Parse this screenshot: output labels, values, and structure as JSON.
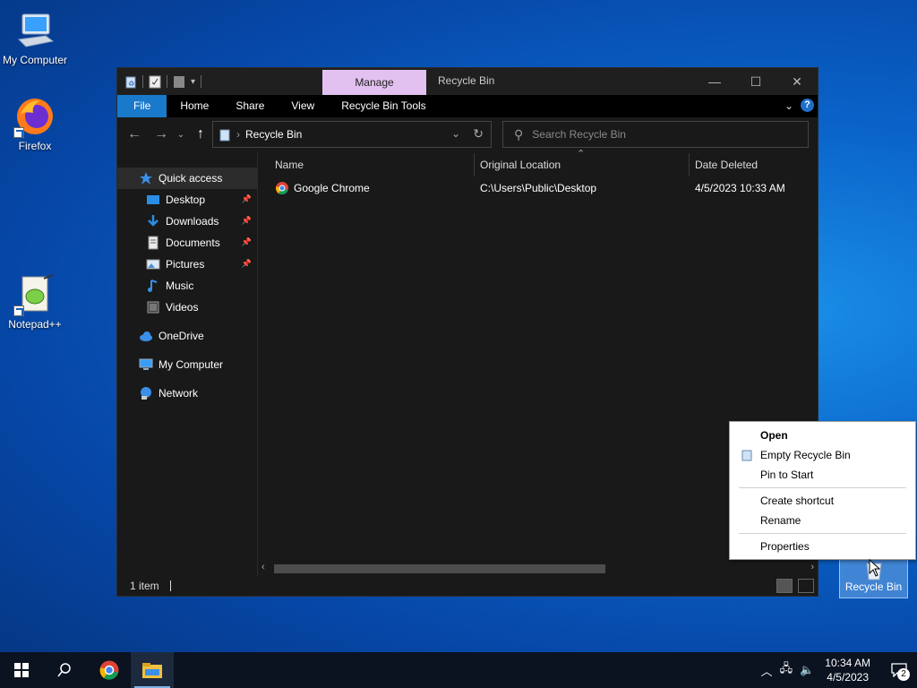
{
  "desktop": {
    "icons": [
      {
        "label": "My Computer"
      },
      {
        "label": "Firefox"
      },
      {
        "label": "Notepad++"
      },
      {
        "label": "Recycle Bin"
      }
    ]
  },
  "window": {
    "context_tab": "Manage",
    "title": "Recycle Bin",
    "ribbon_tabs": [
      "File",
      "Home",
      "Share",
      "View",
      "Recycle Bin Tools"
    ],
    "address_path": "Recycle Bin",
    "search_placeholder": "Search Recycle Bin",
    "sidebar": {
      "items": [
        {
          "label": "Quick access",
          "icon": "star-icon"
        },
        {
          "label": "Desktop",
          "icon": "desktop-folder-icon",
          "pinned": true
        },
        {
          "label": "Downloads",
          "icon": "download-icon",
          "pinned": true
        },
        {
          "label": "Documents",
          "icon": "document-icon",
          "pinned": true
        },
        {
          "label": "Pictures",
          "icon": "pictures-icon",
          "pinned": true
        },
        {
          "label": "Music",
          "icon": "music-icon"
        },
        {
          "label": "Videos",
          "icon": "video-icon"
        },
        {
          "label": "OneDrive",
          "icon": "cloud-icon"
        },
        {
          "label": "My Computer",
          "icon": "computer-icon"
        },
        {
          "label": "Network",
          "icon": "network-icon"
        }
      ]
    },
    "columns": [
      "Name",
      "Original Location",
      "Date Deleted"
    ],
    "rows": [
      {
        "name": "Google Chrome",
        "location": "C:\\Users\\Public\\Desktop",
        "date": "4/5/2023 10:33 AM"
      }
    ],
    "status": "1 item"
  },
  "context_menu": {
    "items": [
      "Open",
      "Empty Recycle Bin",
      "Pin to Start",
      "Create shortcut",
      "Rename",
      "Properties"
    ]
  },
  "taskbar": {
    "time": "10:34 AM",
    "date": "4/5/2023",
    "notification_count": "2"
  }
}
